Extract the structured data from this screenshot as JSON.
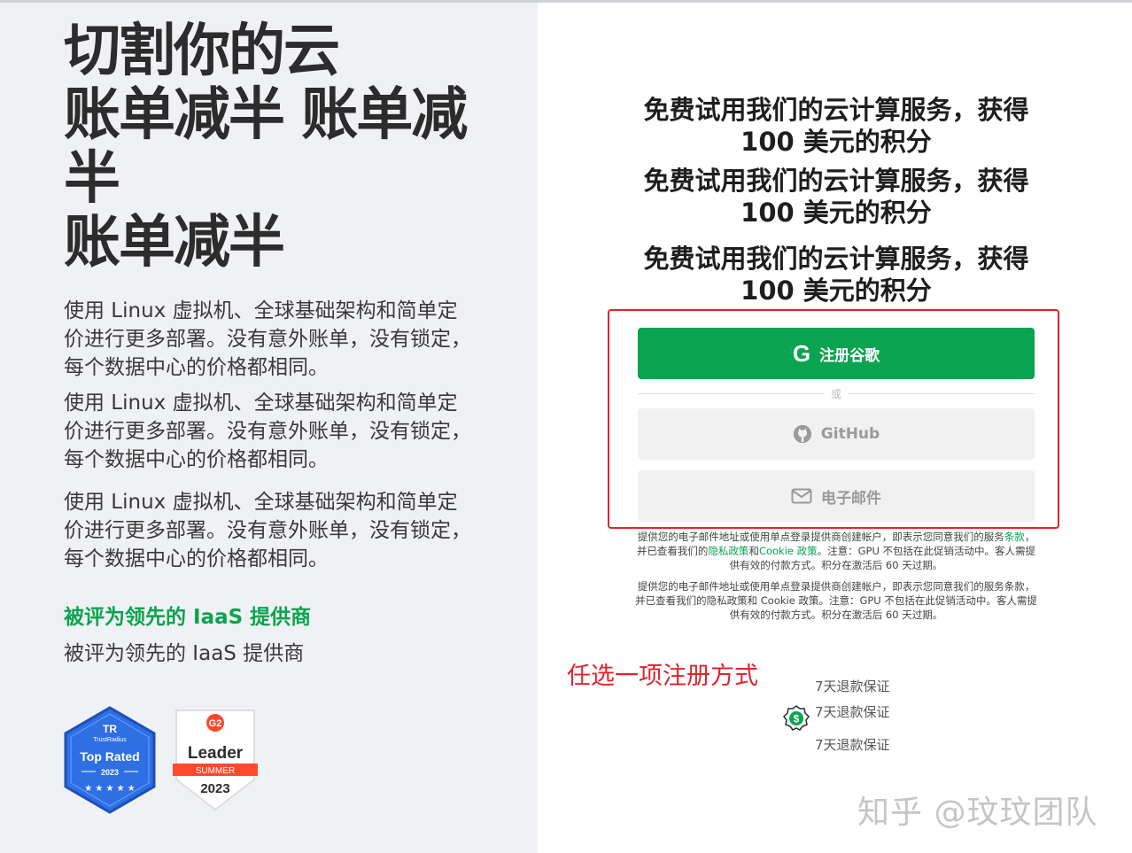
{
  "hero": {
    "headline_lines": [
      "切割你的云",
      "账单减半 账单减",
      "半",
      "账单减半"
    ],
    "paragraphs": [
      "使用 Linux 虚拟机、全球基础架构和简单定价进行更多部署。没有意外账单，没有锁定，每个数据中心的价格都相同。",
      "使用 Linux 虚拟机、全球基础架构和简单定价进行更多部署。没有意外账单，没有锁定，每个数据中心的价格都相同。",
      "使用 Linux 虚拟机、全球基础架构和简单定价进行更多部署。没有意外账单，没有锁定，每个数据中心的价格都相同。"
    ],
    "rated_highlight": "被评为领先的 IaaS 提供商",
    "rated_plain": "被评为领先的 IaaS 提供商",
    "badges": {
      "trustradius": {
        "brand": "TrustRadius",
        "title": "Top Rated",
        "year": "2023"
      },
      "g2": {
        "title": "Leader",
        "season": "SUMMER",
        "year": "2023"
      }
    }
  },
  "signup": {
    "offers": [
      "免费试用我们的云计算服务，获得 100 美元的积分",
      "免费试用我们的云计算服务，获得 100 美元的积分",
      "免费试用我们的云计算服务，获得 100 美元的积分"
    ],
    "google_button": {
      "icon": "google-g-icon",
      "label": "注册谷歌"
    },
    "or_label": "或",
    "github_button": {
      "icon": "github-icon",
      "label": "GitHub"
    },
    "email_button": {
      "icon": "mail-icon",
      "label": "电子邮件"
    },
    "terms": {
      "pre": "提供您的电子邮件地址或使用单点登录提供商创建帐户，即表示您同意我们的服务",
      "terms_link": "条款",
      "mid": "，并已查看我们的",
      "privacy_link": "隐私政策",
      "and": "和",
      "cookie_link": "Cookie 政策",
      "post": "。注意：GPU 不包括在此促销活动中。客人需提供有效的付款方式。积分在激活后 60 天过期。",
      "plain": "提供您的电子邮件地址或使用单点登录提供商创建帐户，即表示您同意我们的服务条款，并已查看我们的隐私政策和 Cookie 政策。注意：GPU 不包括在此促销活动中。客人需提供有效的付款方式。积分在激活后 60 天过期。"
    },
    "refund": [
      "7天退款保证",
      "7天退款保证",
      "7天退款保证"
    ]
  },
  "annotation": "任选一项注册方式",
  "watermark": "知乎 @玟玟团队",
  "colors": {
    "brand_green": "#0aa34f",
    "annotation_red": "#e0242e",
    "left_bg": "#f0f1f4"
  }
}
